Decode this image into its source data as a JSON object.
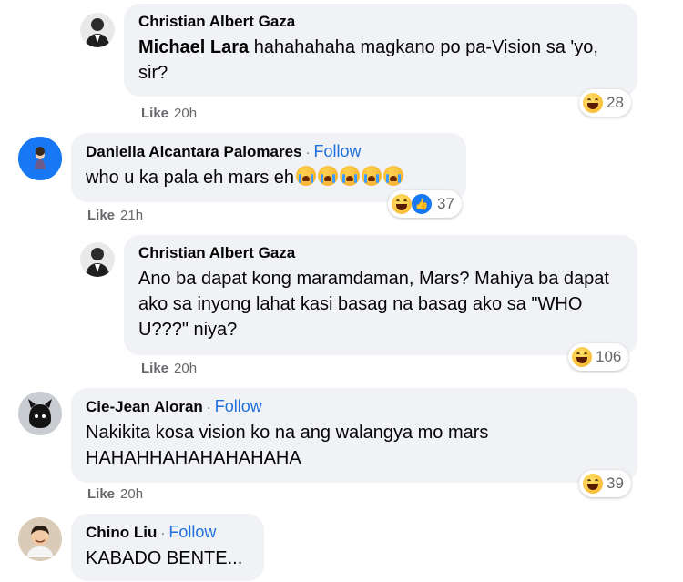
{
  "comments": [
    {
      "author": "Christian Albert Gaza",
      "mention": "Michael Lara",
      "text": "hahahahaha magkano po pa-Vision sa 'yo, sir?",
      "like": "Like",
      "time": "20h",
      "reaction_count": "28",
      "reaction_icons": [
        "haha-icon"
      ]
    },
    {
      "author": "Daniella Alcantara Palomares",
      "follow": "Follow",
      "separator": "·",
      "text": "who u ka pala eh mars eh",
      "emoji_count_in_text": 5,
      "like": "Like",
      "time": "21h",
      "reaction_count": "37",
      "reaction_icons": [
        "haha-icon",
        "like-icon"
      ]
    },
    {
      "author": "Christian Albert Gaza",
      "text": "Ano ba dapat kong maramdaman, Mars? Mahiya ba dapat ako sa inyong lahat kasi basag na basag ako sa \"WHO U???\" niya?",
      "like": "Like",
      "time": "20h",
      "reaction_count": "106",
      "reaction_icons": [
        "haha-icon"
      ]
    },
    {
      "author": "Cie-Jean Aloran",
      "follow": "Follow",
      "separator": "·",
      "text": "Nakikita kosa vision ko na ang walangya mo mars HAHAHHAHAHAHAHAHA",
      "like": "Like",
      "time": "20h",
      "reaction_count": "39",
      "reaction_icons": [
        "haha-icon"
      ]
    },
    {
      "author": "Chino Liu",
      "follow": "Follow",
      "separator": "·",
      "text": "KABADO BENTE..."
    }
  ],
  "colors": {
    "bubble": "#f0f2f5",
    "follow": "#216fdb",
    "meta": "#65676b",
    "like_badge": "#1877f2"
  }
}
